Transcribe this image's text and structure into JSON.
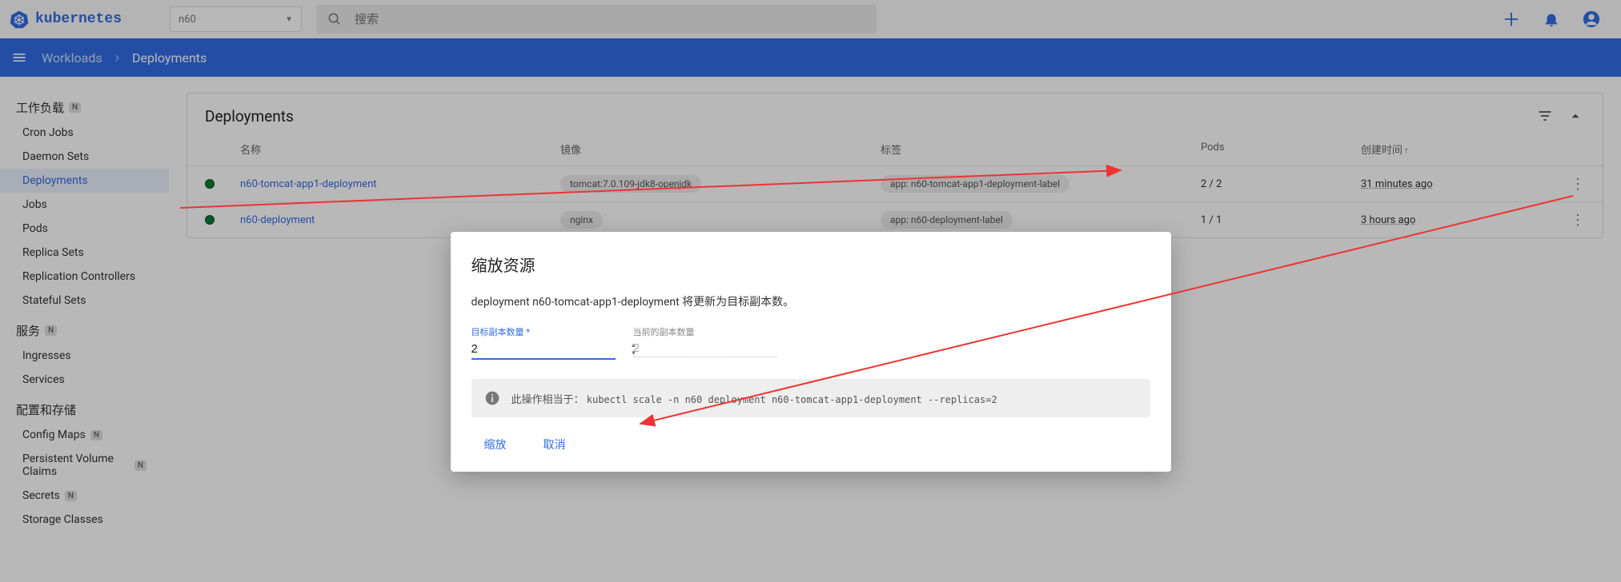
{
  "brand": "kubernetes",
  "namespace": "n60",
  "search_placeholder": "搜索",
  "breadcrumb": {
    "parent": "Workloads",
    "current": "Deployments"
  },
  "sidebar": {
    "groups": [
      {
        "label": "工作负载",
        "badge": "N",
        "items": [
          {
            "label": "Cron Jobs"
          },
          {
            "label": "Daemon Sets"
          },
          {
            "label": "Deployments",
            "active": true
          },
          {
            "label": "Jobs"
          },
          {
            "label": "Pods"
          },
          {
            "label": "Replica Sets"
          },
          {
            "label": "Replication Controllers"
          },
          {
            "label": "Stateful Sets"
          }
        ]
      },
      {
        "label": "服务",
        "badge": "N",
        "items": [
          {
            "label": "Ingresses"
          },
          {
            "label": "Services"
          }
        ]
      },
      {
        "label": "配置和存储",
        "items": [
          {
            "label": "Config Maps",
            "badge": "N"
          },
          {
            "label": "Persistent Volume Claims",
            "badge": "N"
          },
          {
            "label": "Secrets",
            "badge": "N"
          },
          {
            "label": "Storage Classes"
          }
        ]
      }
    ]
  },
  "table": {
    "title": "Deployments",
    "columns": {
      "name": "名称",
      "image": "镜像",
      "labels": "标签",
      "pods": "Pods",
      "created": "创建时间"
    },
    "rows": [
      {
        "name": "n60-tomcat-app1-deployment",
        "image": "tomcat:7.0.109-jdk8-openjdk",
        "label": "app: n60-tomcat-app1-deployment-label",
        "pods": "2 / 2",
        "created": "31 minutes ago"
      },
      {
        "name": "n60-deployment",
        "image": "nginx",
        "label": "app: n60-deployment-label",
        "pods": "1 / 1",
        "created": "3 hours ago"
      }
    ]
  },
  "dialog": {
    "title": "缩放资源",
    "text": "deployment n60-tomcat-app1-deployment 将更新为目标副本数。",
    "target_label": "目标副本数量",
    "current_label": "当前的副本数量",
    "target_value": "2",
    "current_value": "2",
    "hint_prefix": "此操作相当于：",
    "hint_cmd": "kubectl scale -n n60 deployment n60-tomcat-app1-deployment --replicas=2",
    "scale": "缩放",
    "cancel": "取消"
  }
}
